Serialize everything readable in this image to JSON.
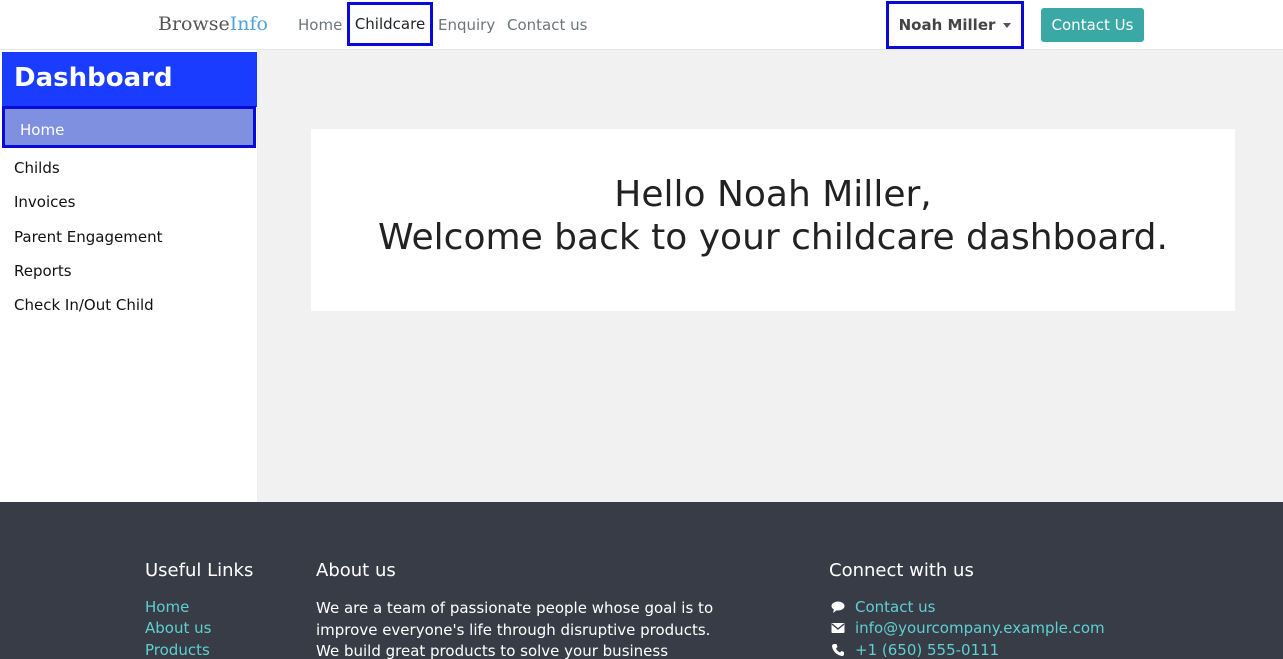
{
  "brand": {
    "part1": "Browse",
    "part2": "Info"
  },
  "nav": {
    "home": "Home",
    "childcare": "Childcare",
    "enquiry": "Enquiry",
    "contact": "Contact us"
  },
  "user": {
    "name": "Noah Miller"
  },
  "contact_button": "Contact Us",
  "sidebar": {
    "header": "Dashboard",
    "items": [
      "Home",
      "Childs",
      "Invoices",
      "Parent Engagement",
      "Reports",
      "Check In/Out Child"
    ]
  },
  "main": {
    "greeting": "Hello Noah Miller,",
    "welcome": "Welcome back to your childcare dashboard."
  },
  "footer": {
    "useful_links": {
      "title": "Useful Links",
      "links": [
        "Home",
        "About us",
        "Products"
      ]
    },
    "about": {
      "title": "About us",
      "text": "We are a team of passionate people whose goal is to improve everyone's life through disruptive products. We build great products to solve your business"
    },
    "connect": {
      "title": "Connect with us",
      "contact": "Contact us",
      "email": "info@yourcompany.example.com",
      "phone": "+1 (650) 555-0111"
    }
  },
  "colors": {
    "accent": "#3aa9a6",
    "sidebar_header": "#1a3cff",
    "footer_bg": "#383c46",
    "footer_link": "#5fcfd1",
    "focus_outline": "#0a0ad6"
  }
}
